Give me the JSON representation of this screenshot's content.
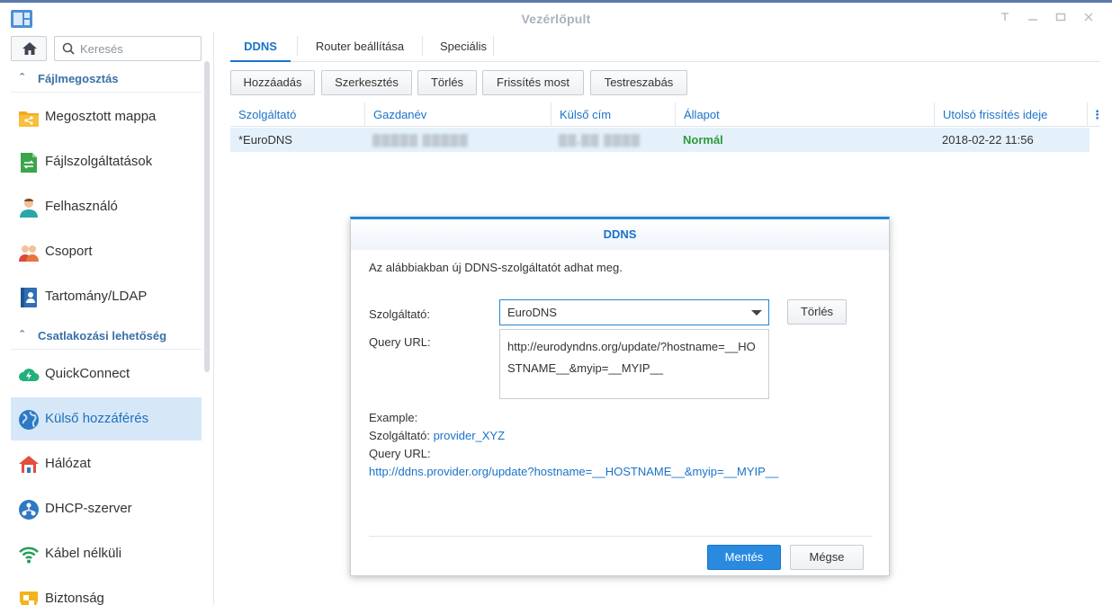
{
  "window": {
    "title": "Vezérlőpult",
    "icons": [
      "app-icon",
      "pin-icon",
      "minimize-icon",
      "maximize-icon",
      "close-icon"
    ]
  },
  "sidebar": {
    "search_placeholder": "Keresés",
    "sections": [
      {
        "label": "Fájlmegosztás",
        "items": [
          {
            "label": "Megosztott mappa",
            "icon": "shared-folder-icon"
          },
          {
            "label": "Fájlszolgáltatások",
            "icon": "file-services-icon"
          },
          {
            "label": "Felhasználó",
            "icon": "user-icon"
          },
          {
            "label": "Csoport",
            "icon": "group-icon"
          },
          {
            "label": "Tartomány/LDAP",
            "icon": "domain-ldap-icon"
          }
        ]
      },
      {
        "label": "Csatlakozási lehetőség",
        "items": [
          {
            "label": "QuickConnect",
            "icon": "quickconnect-icon"
          },
          {
            "label": "Külső hozzáférés",
            "icon": "globe-icon",
            "active": true
          },
          {
            "label": "Hálózat",
            "icon": "network-house-icon"
          },
          {
            "label": "DHCP-szerver",
            "icon": "dhcp-icon"
          },
          {
            "label": "Kábel nélküli",
            "icon": "wifi-icon"
          },
          {
            "label": "Biztonság",
            "icon": "security-shield-icon"
          }
        ]
      }
    ]
  },
  "tabs": [
    "DDNS",
    "Router beállítása",
    "Speciális"
  ],
  "toolbar": [
    "Hozzáadás",
    "Szerkesztés",
    "Törlés",
    "Frissítés most",
    "Testreszabás"
  ],
  "grid": {
    "columns": [
      "Szolgáltató",
      "Gazdanév",
      "Külső cím",
      "Állapot",
      "Utolsó frissítés ideje"
    ],
    "rows": [
      {
        "provider": "*EuroDNS",
        "hostname": "▒▒▒▒▒ ▒▒▒▒▒",
        "external": "▒▒.▒▒ ▒▒▒▒",
        "status": "Normál",
        "updated": "2018-02-22 11:56"
      }
    ]
  },
  "dialog": {
    "title": "DDNS",
    "intro": "Az alábbiakban új DDNS-szolgáltatót adhat meg.",
    "provider_label": "Szolgáltató:",
    "provider_value": "EuroDNS",
    "delete_button": "Törlés",
    "query_label": "Query URL:",
    "query_value": "http://eurodyndns.org/update/?hostname=__HOSTNAME__&myip=__MYIP__",
    "example_label": "Example:",
    "example_provider_label": "Szolgáltató:",
    "example_provider_value": "provider_XYZ",
    "example_query_label": "Query URL:",
    "example_query_value": "http://ddns.provider.org/update?hostname=__HOSTNAME__&myip=__MYIP__",
    "save_button": "Mentés",
    "cancel_button": "Mégse"
  },
  "colors": {
    "accent": "#1a73c8",
    "status_ok": "#2d9a3a",
    "active_nav_bg": "#d6e8f7"
  }
}
